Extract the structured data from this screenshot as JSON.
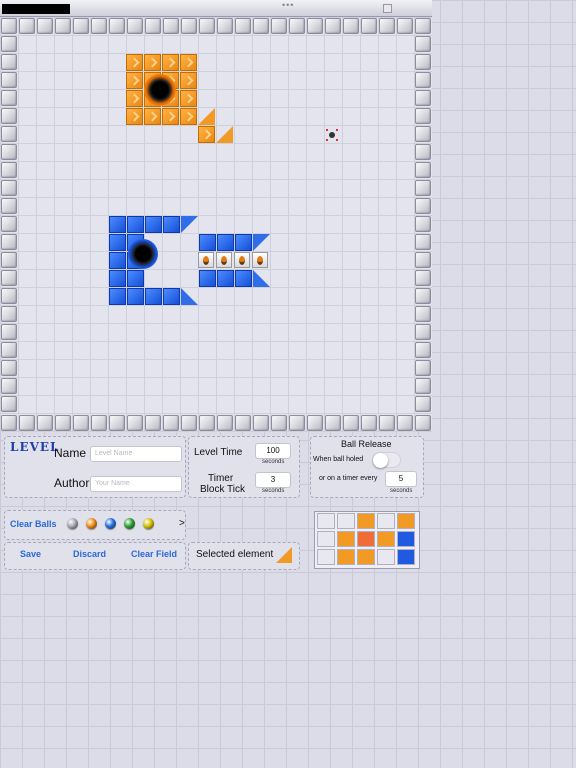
{
  "top_bar": {
    "dots": "•••"
  },
  "level_panel": {
    "logo": "LEVEL",
    "name_label": "Name",
    "name_placeholder": "Level Name",
    "author_label": "Author",
    "author_placeholder": "Your Name"
  },
  "level_time": {
    "label": "Level Time",
    "value": "100",
    "unit": "seconds"
  },
  "timer_block_tick": {
    "label_line1": "Timer",
    "label_line2": "Block Tick",
    "value": "3",
    "unit": "seconds"
  },
  "ball_release": {
    "title": "Ball Release",
    "when_holed_label": "When ball holed",
    "toggle_on": false,
    "timer_label": "or on a timer every",
    "timer_value": "5",
    "timer_unit": "seconds"
  },
  "balls_panel": {
    "clear_balls": "Clear Balls",
    "balls": [
      {
        "name": "silver-ball",
        "color": "#a8a8b0"
      },
      {
        "name": "orange-ball",
        "color": "#f08a10"
      },
      {
        "name": "blue-ball",
        "color": "#1f6ee0"
      },
      {
        "name": "green-ball",
        "color": "#28a030"
      },
      {
        "name": "yellow-ball",
        "color": "#d4c000"
      }
    ],
    "more": ">"
  },
  "actions": {
    "save": "Save",
    "discard": "Discard",
    "clear_field": "Clear Field"
  },
  "selected_element": {
    "label": "Selected element",
    "icon": "orange-triangle-icon"
  },
  "colors": {
    "accent": "#2a68d8",
    "orange": "#f29a26",
    "blue": "#1f5ae0",
    "logo": "#1f3fae"
  }
}
